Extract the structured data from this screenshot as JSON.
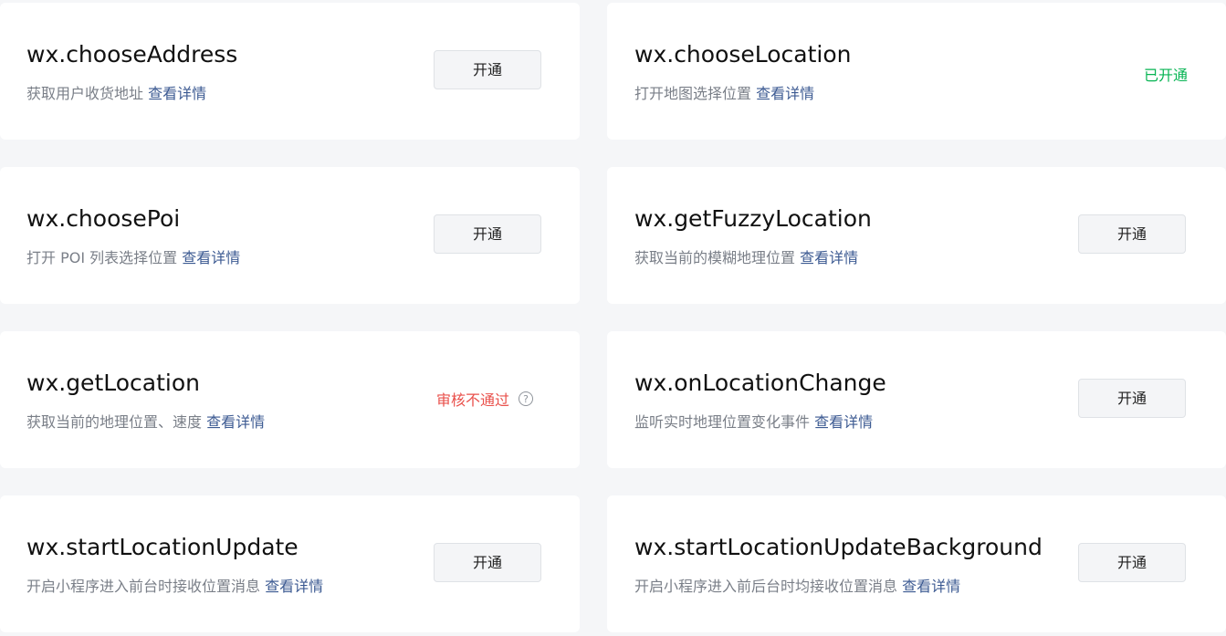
{
  "apis": [
    {
      "name": "wx.chooseAddress",
      "desc": "获取用户收货地址",
      "link": "查看详情",
      "action": "开通"
    },
    {
      "name": "wx.chooseLocation",
      "desc": "打开地图选择位置",
      "link": "查看详情",
      "status": "已开通"
    },
    {
      "name": "wx.choosePoi",
      "desc": "打开 POI 列表选择位置",
      "link": "查看详情",
      "action": "开通"
    },
    {
      "name": "wx.getFuzzyLocation",
      "desc": "获取当前的模糊地理位置",
      "link": "查看详情",
      "action": "开通"
    },
    {
      "name": "wx.getLocation",
      "desc": "获取当前的地理位置、速度",
      "link": "查看详情",
      "status": "审核不通过"
    },
    {
      "name": "wx.onLocationChange",
      "desc": "监听实时地理位置变化事件",
      "link": "查看详情",
      "action": "开通"
    },
    {
      "name": "wx.startLocationUpdate",
      "desc": "开启小程序进入前台时接收位置消息",
      "link": "查看详情",
      "action": "开通"
    },
    {
      "name": "wx.startLocationUpdateBackground",
      "desc": "开启小程序进入前后台时均接收位置消息",
      "link": "查看详情",
      "action": "开通"
    }
  ],
  "icons": {
    "help": "?"
  },
  "colors": {
    "opened": "#07b453",
    "rejected": "#e9504b",
    "link": "#3c5a92"
  }
}
